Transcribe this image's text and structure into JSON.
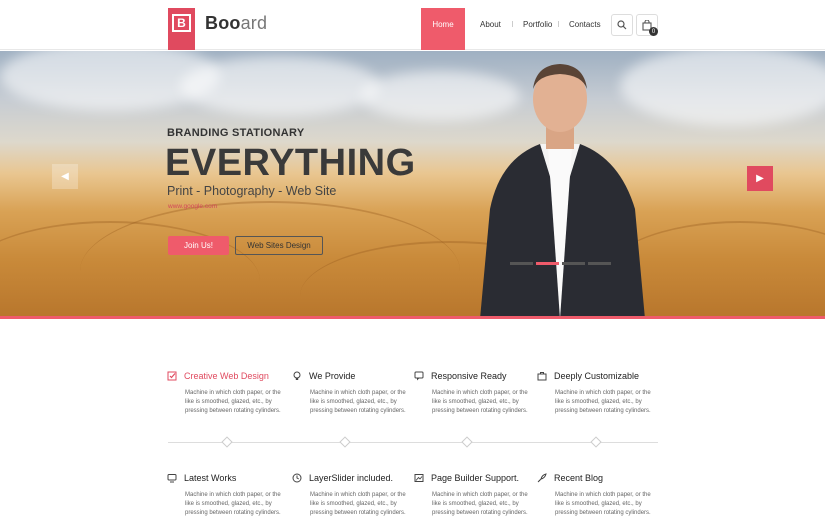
{
  "brand": {
    "letter": "B",
    "name_bold": "Boo",
    "name_light": "ard"
  },
  "nav": {
    "home": "Home",
    "about": "About",
    "portfolio": "Portfolio",
    "contacts": "Contacts",
    "cart_count": "0"
  },
  "hero": {
    "subtitle": "BRANDING STATIONARY",
    "title": "EVERYTHING",
    "tagline": "Print - Photography - Web Site",
    "link": "www.google.com",
    "btn_join": "Join Us!",
    "btn_web": "Web Sites Design",
    "slides_total": 4,
    "active_slide": 2
  },
  "features": [
    {
      "title": "Creative Web Design",
      "icon": "checkbox-icon",
      "desc": "Machine in which cloth paper, or the like is smoothed, glazed, etc., by pressing between rotating cylinders."
    },
    {
      "title": "We Provide",
      "icon": "lightbulb-icon",
      "desc": "Machine in which cloth paper, or the like is smoothed, glazed, etc., by pressing between rotating cylinders."
    },
    {
      "title": "Responsive Ready",
      "icon": "chat-icon",
      "desc": "Machine in which cloth paper, or the like is smoothed, glazed, etc., by pressing between rotating cylinders."
    },
    {
      "title": "Deeply Customizable",
      "icon": "briefcase-icon",
      "desc": "Machine in which cloth paper, or the like is smoothed, glazed, etc., by pressing between rotating cylinders."
    },
    {
      "title": "Latest Works",
      "icon": "monitor-icon",
      "desc": "Machine in which cloth paper, or the like is smoothed, glazed, etc., by pressing between rotating cylinders."
    },
    {
      "title": "LayerSlider included.",
      "icon": "clock-icon",
      "desc": "Machine in which cloth paper, or the like is smoothed, glazed, etc., by pressing between rotating cylinders."
    },
    {
      "title": "Page Builder Support.",
      "icon": "image-icon",
      "desc": "Machine in which cloth paper, or the like is smoothed, glazed, etc., by pressing between rotating cylinders."
    },
    {
      "title": "Recent Blog",
      "icon": "rocket-icon",
      "desc": "Machine in which cloth paper, or the like is smoothed, glazed, etc., by pressing between rotating cylinders."
    }
  ],
  "colors": {
    "accent": "#ef5b6b",
    "logo": "#e04a5f"
  }
}
